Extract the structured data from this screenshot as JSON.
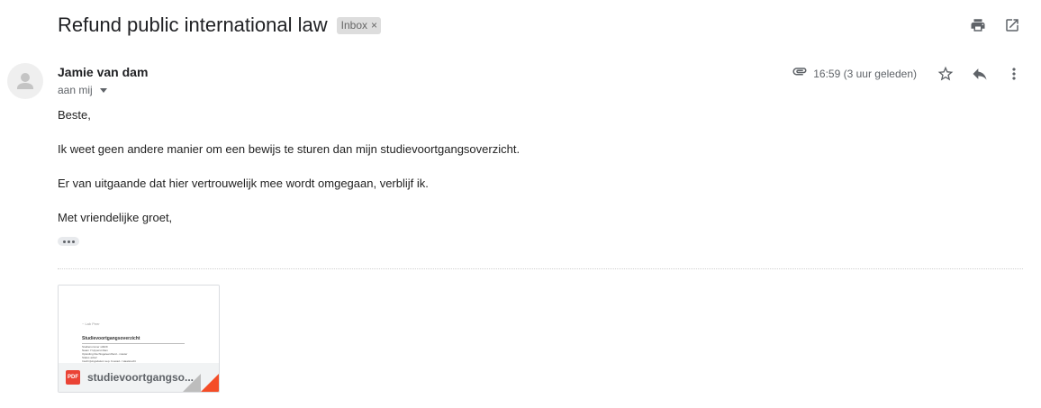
{
  "email": {
    "subject": "Refund public international law",
    "label": "Inbox",
    "label_remove": "×",
    "sender_name": "Jamie van dam",
    "recipient": "aan mij",
    "time": "16:59 (3 uur geleden)",
    "body": [
      "Beste,",
      "Ik weet geen andere manier om een bewijs te sturen dan mijn studievoortgangsoverzicht.",
      "Er van uitgaande dat hier vertrouwelijk mee wordt omgegaan, verblijf ik.",
      "Met vriendelijke groet,"
    ]
  },
  "attachment": {
    "type_badge": "PDF",
    "name": "studievoortgangso...",
    "preview": {
      "header": "~ Lab Peer",
      "title": "Studievoortgangsoverzicht",
      "rows": [
        "Studienummer         s4629",
        "Naam                 Y.Upperst.Dam",
        "Opleiding            Rechtsgeleerdheid - master",
        "Status               actief",
        "Inschrijvingsdatum   sep. bi.acad. / staatsrecht"
      ]
    }
  },
  "icons": {
    "print": "print-icon",
    "open_new_window": "open-in-new-window-icon",
    "attachment": "paperclip-icon",
    "star": "star-icon",
    "reply": "reply-icon",
    "more": "more-vertical-icon",
    "avatar": "person-icon"
  },
  "colors": {
    "pdf_red": "#ea4335",
    "fold_orange": "#f44d27",
    "label_bg": "#dddddd"
  }
}
